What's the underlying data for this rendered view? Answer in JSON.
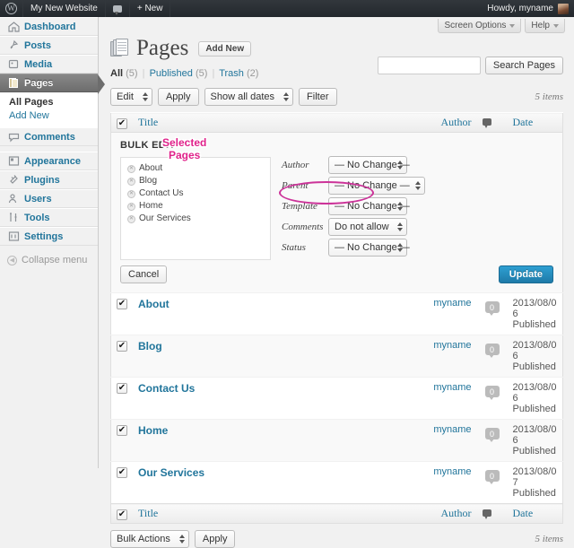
{
  "adminbar": {
    "logo_icon": "wordpress-logo-icon",
    "site_name": "My New Website",
    "comments_icon": "comment-bubble-icon",
    "new_label": "+ New",
    "howdy": "Howdy, myname",
    "avatar_icon": "user-avatar"
  },
  "sidebar": {
    "items": [
      {
        "label": "Dashboard",
        "icon": "dashboard-icon"
      },
      {
        "label": "Posts",
        "icon": "pin-icon"
      },
      {
        "label": "Media",
        "icon": "media-icon"
      },
      {
        "label": "Pages",
        "icon": "pages-icon"
      },
      {
        "label": "Comments",
        "icon": "comment-bubble-icon"
      },
      {
        "label": "Appearance",
        "icon": "appearance-icon"
      },
      {
        "label": "Plugins",
        "icon": "plugin-icon"
      },
      {
        "label": "Users",
        "icon": "users-icon"
      },
      {
        "label": "Tools",
        "icon": "tools-icon"
      },
      {
        "label": "Settings",
        "icon": "settings-icon"
      }
    ],
    "submenu": [
      {
        "label": "All Pages",
        "active": true
      },
      {
        "label": "Add New",
        "active": false
      }
    ],
    "collapse_label": "Collapse menu",
    "collapse_icon": "collapse-arrow-icon"
  },
  "screen_meta": {
    "screen_options": "Screen Options",
    "help": "Help"
  },
  "header": {
    "icon": "pages-stack-icon",
    "title": "Pages",
    "add_new": "Add New"
  },
  "filters": {
    "all_label": "All",
    "all_count": "(5)",
    "published_label": "Published",
    "published_count": "(5)",
    "trash_label": "Trash",
    "trash_count": "(2)",
    "divider": "|"
  },
  "search": {
    "value": "",
    "placeholder": "",
    "button": "Search Pages"
  },
  "tablenav_top": {
    "bulk_select": "Edit",
    "apply": "Apply",
    "dates_select": "Show all dates",
    "filter": "Filter",
    "items_count": "5 items"
  },
  "tablenav_bottom": {
    "bulk_select": "Bulk Actions",
    "apply": "Apply",
    "items_count": "5 items"
  },
  "table": {
    "columns": {
      "title": "Title",
      "author": "Author",
      "comments_icon": "comment-bubble-icon",
      "date": "Date"
    },
    "rows": [
      {
        "title": "About",
        "author": "myname",
        "comments": "0",
        "date": "2013/08/0",
        "date2": "6",
        "status": "Published"
      },
      {
        "title": "Blog",
        "author": "myname",
        "comments": "0",
        "date": "2013/08/0",
        "date2": "6",
        "status": "Published"
      },
      {
        "title": "Contact Us",
        "author": "myname",
        "comments": "0",
        "date": "2013/08/0",
        "date2": "6",
        "status": "Published"
      },
      {
        "title": "Home",
        "author": "myname",
        "comments": "0",
        "date": "2013/08/0",
        "date2": "6",
        "status": "Published"
      },
      {
        "title": "Our Services",
        "author": "myname",
        "comments": "0",
        "date": "2013/08/0",
        "date2": "7",
        "status": "Published"
      }
    ]
  },
  "bulk_edit": {
    "heading": "BULK EDIT",
    "selected_pages": [
      {
        "label": "About"
      },
      {
        "label": "Blog"
      },
      {
        "label": "Contact Us"
      },
      {
        "label": "Home"
      },
      {
        "label": "Our Services"
      }
    ],
    "fields": [
      {
        "label": "Author",
        "value": "— No Change —"
      },
      {
        "label": "Parent",
        "value": "— No Change —"
      },
      {
        "label": "Template",
        "value": "— No Change —"
      },
      {
        "label": "Comments",
        "value": "Do not allow"
      },
      {
        "label": "Status",
        "value": "— No Change —"
      }
    ],
    "cancel": "Cancel",
    "update": "Update"
  },
  "annotations": {
    "selected_pages_line1": "Selected",
    "selected_pages_line2": "Pages",
    "color": "#e0218a",
    "ellipse_color": "#cc3399"
  }
}
